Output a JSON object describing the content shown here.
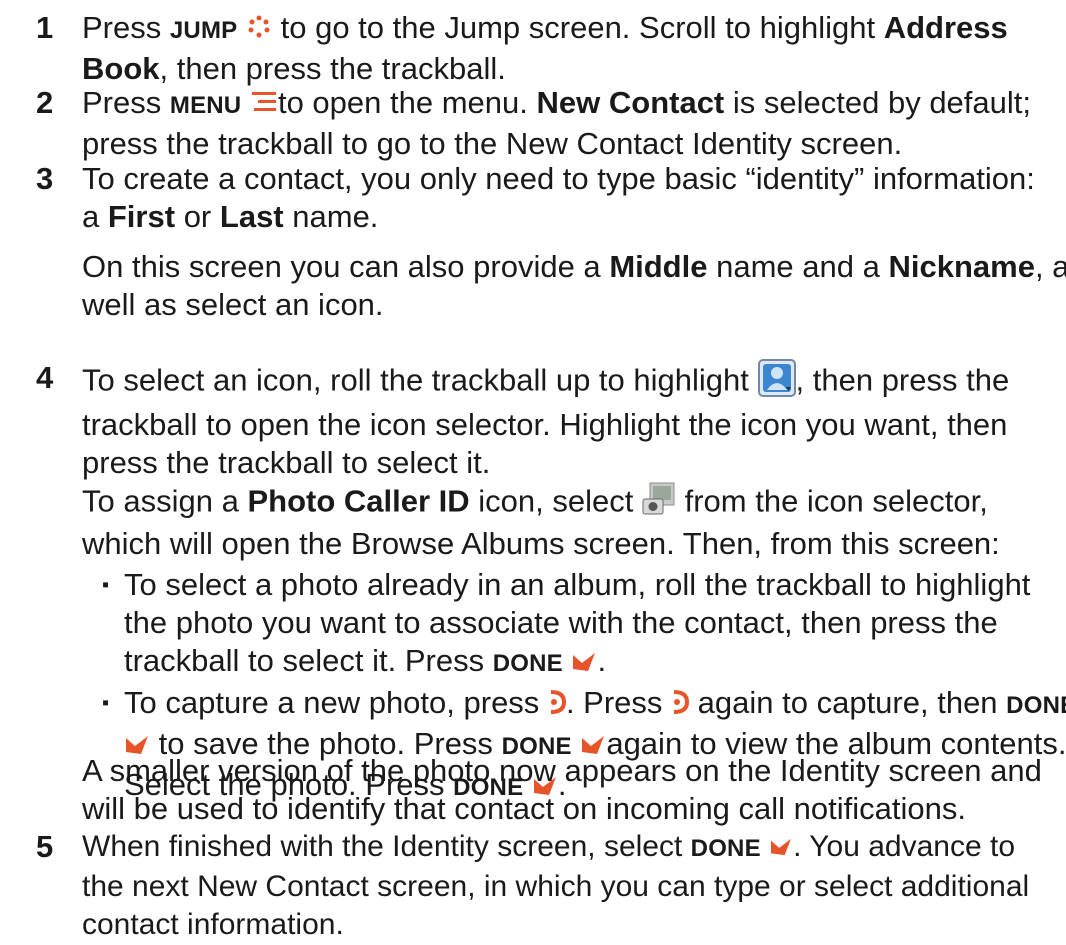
{
  "steps": {
    "s1": {
      "num": "1",
      "l1a": "Press",
      "key": "JUMP",
      "l1b": "to go to the Jump screen. Scroll to highlight",
      "l1c": "Address",
      "l2a": "Book",
      "l2b": ", then press the trackball."
    },
    "s2": {
      "num": "2",
      "l1a": "Press",
      "key": "MENU",
      "l1b": "to open the menu.",
      "l1c": "New Contact",
      "l1d": "is selected by default;",
      "l2": "press the trackball to go to the New Contact Identity screen."
    },
    "s3": {
      "num": "3",
      "l1": "To create a contact, you only need to type basic “identity” information:",
      "l2a": "a",
      "l2b": "First",
      "l2c": "or",
      "l2d": "Last",
      "l2e": "name.",
      "l3a": "On this screen you can also provide a",
      "l3b": "Middle",
      "l3c": "name and a",
      "l3d": "Nickname",
      "l3e": ", as",
      "l4": "well as select an icon."
    },
    "s4": {
      "num": "4",
      "l1a": "To select an icon, roll the trackball up to highlight",
      "l1b": ", then press the",
      "l2": "trackball to open the icon selector. Highlight the icon you want, then",
      "l3": "press the trackball to select it.",
      "l4a": "To assign a",
      "l4b": "Photo Caller ID",
      "l4c": "icon, select",
      "l4d": "from the icon selector,",
      "l5": "which will open the Browse Albums screen. Then, from this screen:",
      "b1": {
        "l1": "To select a photo already in an album, roll the trackball to highlight",
        "l2": "the photo you want to associate with the contact, then press the",
        "l3a": "trackball to select it. Press",
        "l3key": "DONE"
      },
      "b2": {
        "l1a": "To capture a new photo, press",
        "l1b": ". Press",
        "l1c": "again to capture, then",
        "l1key": "DONE",
        "l2a": "to save the photo. Press",
        "l2key": "DONE",
        "l2b": "again to view the album contents.",
        "l3a": "Select the photo. Press",
        "l3key": "DONE"
      },
      "l6": "A smaller version of the photo now appears on the Identity screen and",
      "l7": "will be used to identify that contact on incoming call notifications."
    },
    "s5": {
      "num": "5",
      "l1a": "When finished with the Identity screen, select",
      "l1key": "DONE",
      "l1b": ". You advance to",
      "l2": "the next New Contact screen, in which you can type or select additional",
      "l3": "contact information."
    }
  },
  "colors": {
    "accent": "#e8542a",
    "text": "#1a1a1a"
  },
  "icons": [
    "jump-icon",
    "menu-icon",
    "contact-icon",
    "photo-caller-id-icon",
    "done-check-icon",
    "capture-icon"
  ]
}
